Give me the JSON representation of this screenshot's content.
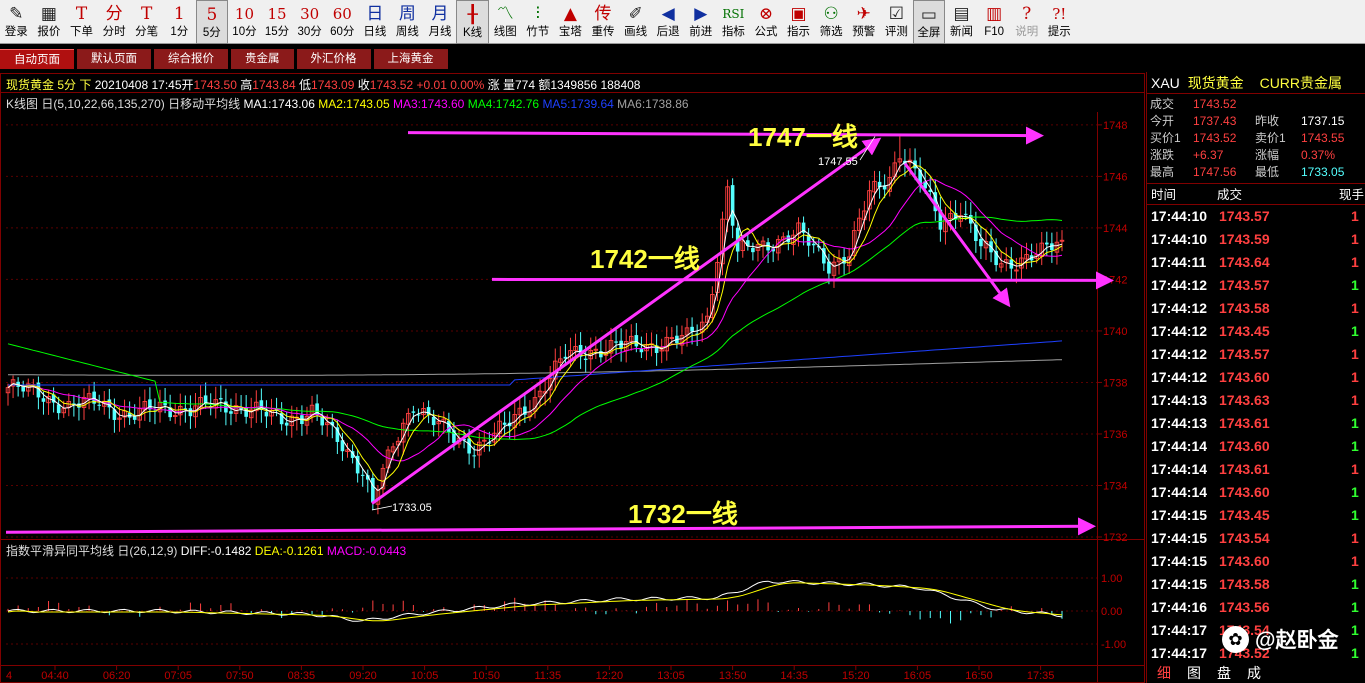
{
  "toolbar": {
    "items": [
      {
        "icon": "pencil-icon",
        "glyph": "✎",
        "label": "登录"
      },
      {
        "icon": "quote-icon",
        "glyph": "▦",
        "label": "报价"
      },
      {
        "icon": "order-icon",
        "glyph": "T",
        "label": "下单"
      },
      {
        "icon": "timeshare-icon",
        "glyph": "分",
        "label": "分时"
      },
      {
        "icon": "tick-icon",
        "glyph": "T",
        "label": "分笔"
      },
      {
        "icon": "1min-icon",
        "glyph": "1",
        "label": "1分"
      },
      {
        "icon": "5min-icon",
        "glyph": "5",
        "label": "5分"
      },
      {
        "icon": "10min-icon",
        "glyph": "10",
        "label": "10分"
      },
      {
        "icon": "15min-icon",
        "glyph": "15",
        "label": "15分"
      },
      {
        "icon": "30min-icon",
        "glyph": "30",
        "label": "30分"
      },
      {
        "icon": "60min-icon",
        "glyph": "60",
        "label": "60分"
      },
      {
        "icon": "day-icon",
        "glyph": "日",
        "label": "日线"
      },
      {
        "icon": "week-icon",
        "glyph": "周",
        "label": "周线"
      },
      {
        "icon": "month-icon",
        "glyph": "月",
        "label": "月线"
      },
      {
        "icon": "kline-icon",
        "glyph": "╂",
        "label": "K线"
      },
      {
        "icon": "linechart-icon",
        "glyph": "〽",
        "label": "线图"
      },
      {
        "icon": "bamboo-icon",
        "glyph": "⫶",
        "label": "竹节"
      },
      {
        "icon": "pagoda-icon",
        "glyph": "▲",
        "label": "宝塔"
      },
      {
        "icon": "overlay-icon",
        "glyph": "传",
        "label": "重传"
      },
      {
        "icon": "drawline-icon",
        "glyph": "✐",
        "label": "画线"
      },
      {
        "icon": "back-icon",
        "glyph": "◀",
        "label": "后退"
      },
      {
        "icon": "forward-icon",
        "glyph": "▶",
        "label": "前进"
      },
      {
        "icon": "indicator-icon",
        "glyph": "RSI",
        "label": "指标"
      },
      {
        "icon": "formula-icon",
        "glyph": "⊗",
        "label": "公式"
      },
      {
        "icon": "indicate-icon",
        "glyph": "▣",
        "label": "指示"
      },
      {
        "icon": "filter-icon",
        "glyph": "⚇",
        "label": "筛选"
      },
      {
        "icon": "alert-icon",
        "glyph": "✈",
        "label": "预警"
      },
      {
        "icon": "evaluate-icon",
        "glyph": "☑",
        "label": "评测"
      },
      {
        "icon": "fullscreen-icon",
        "glyph": "▭",
        "label": "全屏"
      },
      {
        "icon": "news-icon",
        "glyph": "▤",
        "label": "新闻"
      },
      {
        "icon": "f10-icon",
        "glyph": "▥",
        "label": "F10"
      },
      {
        "icon": "help-icon",
        "glyph": "?",
        "label": "说明"
      },
      {
        "icon": "hint-icon",
        "glyph": "?!",
        "label": "提示"
      }
    ]
  },
  "tabs": [
    "自动页面",
    "默认页面",
    "综合报价",
    "贵金属",
    "外汇价格",
    "上海黄金"
  ],
  "header": {
    "name": "现货黄金",
    "period": "5分",
    "direction": "下",
    "datetime": "20210408 17:45",
    "open_label": "开",
    "open": "1743.50",
    "high_label": "高",
    "high": "1743.84",
    "low_label": "低",
    "low": "1743.09",
    "close_label": "收",
    "close": "1743.52",
    "change": "+0.01",
    "change_pct": "0.00%",
    "rise_label": "涨",
    "vol_label": "量",
    "vol": "774",
    "amount_label": "额",
    "amount": "1349856",
    "extra": "188408"
  },
  "ma_line": {
    "title": "K线图",
    "ind": "日移动平均线",
    "params": "日(5,10,22,66,135,270)",
    "ma1": "MA1:1743.06",
    "ma2": "MA2:1743.05",
    "ma3": "MA3:1743.60",
    "ma4": "MA4:1742.76",
    "ma5": "MA5:1739.64",
    "ma6": "MA6:1738.86"
  },
  "macd_line": {
    "ind": "指数平滑异同平均线",
    "params": "日(26,12,9)",
    "diff": "DIFF:-0.1482",
    "dea": "DEA:-0.1261",
    "macd": "MACD:-0.0443"
  },
  "annotations": {
    "high_label": "1747.55",
    "low_label": "1733.05",
    "line1747": "1747一线",
    "line1742": "1742一线",
    "line1732": "1732一线"
  },
  "colors": {
    "up": "#ff4040",
    "down": "#54ffff",
    "annot": "#ff33ff",
    "ma1": "#ffffff",
    "ma2": "#ffff00",
    "ma3": "#ff00ff",
    "ma4": "#00ff00",
    "ma5": "#1e40ff",
    "ma6": "#a0a0a0"
  },
  "right_panel": {
    "symbol": "XAU",
    "name": "现货黄金",
    "category": "CURR贵金属",
    "last_label": "成交",
    "last": "1743.52",
    "rows": [
      {
        "l1": "今开",
        "v1": "1737.43",
        "l2": "昨收",
        "v2": "1737.15"
      },
      {
        "l1": "买价1",
        "v1": "1743.52",
        "l2": "卖价1",
        "v2": "1743.55"
      },
      {
        "l1": "涨跌",
        "v1": "+6.37",
        "l2": "涨幅",
        "v2": "0.37%"
      },
      {
        "l1": "最高",
        "v1": "1747.56",
        "l2": "最低",
        "v2": "1733.05"
      }
    ],
    "table_headers": [
      "时间",
      "成交",
      "现手"
    ],
    "ticks": [
      {
        "t": "17:44:10",
        "p": "1743.57",
        "v": "1",
        "up": true
      },
      {
        "t": "17:44:10",
        "p": "1743.59",
        "v": "1",
        "up": true
      },
      {
        "t": "17:44:11",
        "p": "1743.64",
        "v": "1",
        "up": true
      },
      {
        "t": "17:44:12",
        "p": "1743.57",
        "v": "1",
        "up": false
      },
      {
        "t": "17:44:12",
        "p": "1743.58",
        "v": "1",
        "up": true
      },
      {
        "t": "17:44:12",
        "p": "1743.45",
        "v": "1",
        "up": false
      },
      {
        "t": "17:44:12",
        "p": "1743.57",
        "v": "1",
        "up": true
      },
      {
        "t": "17:44:12",
        "p": "1743.60",
        "v": "1",
        "up": true
      },
      {
        "t": "17:44:13",
        "p": "1743.63",
        "v": "1",
        "up": true
      },
      {
        "t": "17:44:13",
        "p": "1743.61",
        "v": "1",
        "up": false
      },
      {
        "t": "17:44:14",
        "p": "1743.60",
        "v": "1",
        "up": false
      },
      {
        "t": "17:44:14",
        "p": "1743.61",
        "v": "1",
        "up": true
      },
      {
        "t": "17:44:14",
        "p": "1743.60",
        "v": "1",
        "up": false
      },
      {
        "t": "17:44:15",
        "p": "1743.45",
        "v": "1",
        "up": false
      },
      {
        "t": "17:44:15",
        "p": "1743.54",
        "v": "1",
        "up": true
      },
      {
        "t": "17:44:15",
        "p": "1743.60",
        "v": "1",
        "up": true
      },
      {
        "t": "17:44:15",
        "p": "1743.58",
        "v": "1",
        "up": false
      },
      {
        "t": "17:44:16",
        "p": "1743.56",
        "v": "1",
        "up": false
      },
      {
        "t": "17:44:17",
        "p": "1743.54",
        "v": "1",
        "up": false
      },
      {
        "t": "17:44:17",
        "p": "1743.52",
        "v": "1",
        "up": false
      }
    ],
    "bottom_tabs": [
      "细",
      "图",
      "盘",
      "成"
    ]
  },
  "watermark": "@赵卧金",
  "chart_data": {
    "type": "candlestick",
    "title": "现货黄金 5分",
    "y_ticks": [
      1732,
      1734,
      1736,
      1738,
      1740,
      1742,
      1744,
      1746,
      1748
    ],
    "ylim": [
      1732,
      1748.5
    ],
    "x_ticks": [
      "04:40",
      "06:20",
      "07:05",
      "07:50",
      "08:35",
      "09:20",
      "10:05",
      "10:50",
      "11:35",
      "12:20",
      "13:05",
      "13:50",
      "14:35",
      "15:20",
      "16:05",
      "16:50",
      "17:35"
    ],
    "x_start_label": "4",
    "macd_ticks": [
      "1.00",
      "0.00",
      "-1.00"
    ],
    "macd_ylim": [
      -1.0,
      1.0
    ],
    "high": 1747.55,
    "low": 1733.05,
    "close_anchors": [
      [
        0,
        1737.8
      ],
      [
        6,
        1737.6
      ],
      [
        12,
        1737.0
      ],
      [
        18,
        1737.3
      ],
      [
        24,
        1736.6
      ],
      [
        30,
        1737.1
      ],
      [
        36,
        1736.9
      ],
      [
        42,
        1737.2
      ],
      [
        48,
        1736.9
      ],
      [
        54,
        1736.6
      ],
      [
        60,
        1736.8
      ],
      [
        66,
        1735.6
      ],
      [
        70,
        1734.6
      ],
      [
        72,
        1733.4
      ],
      [
        76,
        1735.5
      ],
      [
        80,
        1737.2
      ],
      [
        84,
        1736.5
      ],
      [
        88,
        1735.8
      ],
      [
        92,
        1735.5
      ],
      [
        98,
        1736.2
      ],
      [
        104,
        1737.4
      ],
      [
        110,
        1739.0
      ],
      [
        116,
        1739.3
      ],
      [
        122,
        1739.4
      ],
      [
        128,
        1739.5
      ],
      [
        134,
        1739.7
      ],
      [
        138,
        1740.5
      ],
      [
        142,
        1745.5
      ],
      [
        144,
        1743.0
      ],
      [
        150,
        1743.4
      ],
      [
        156,
        1743.8
      ],
      [
        162,
        1742.6
      ],
      [
        166,
        1743.0
      ],
      [
        170,
        1745.3
      ],
      [
        174,
        1746.0
      ],
      [
        176,
        1747.0
      ],
      [
        180,
        1745.8
      ],
      [
        184,
        1744.2
      ],
      [
        188,
        1744.8
      ],
      [
        192,
        1743.2
      ],
      [
        196,
        1742.6
      ],
      [
        200,
        1742.8
      ],
      [
        204,
        1743.0
      ],
      [
        208,
        1743.52
      ]
    ],
    "macd_anchors": [
      [
        0,
        0.0
      ],
      [
        30,
        0.0
      ],
      [
        60,
        -0.1
      ],
      [
        70,
        -0.3
      ],
      [
        80,
        -0.1
      ],
      [
        100,
        0.2
      ],
      [
        120,
        0.35
      ],
      [
        140,
        0.4
      ],
      [
        150,
        0.9
      ],
      [
        170,
        0.8
      ],
      [
        180,
        0.7
      ],
      [
        195,
        0.05
      ],
      [
        208,
        -0.13
      ]
    ],
    "lines": [
      {
        "label": "1747一线",
        "price": 1747.7
      },
      {
        "label": "1742一线",
        "price": 1742.0
      },
      {
        "label": "1732一线",
        "price": 1732.3
      }
    ]
  }
}
